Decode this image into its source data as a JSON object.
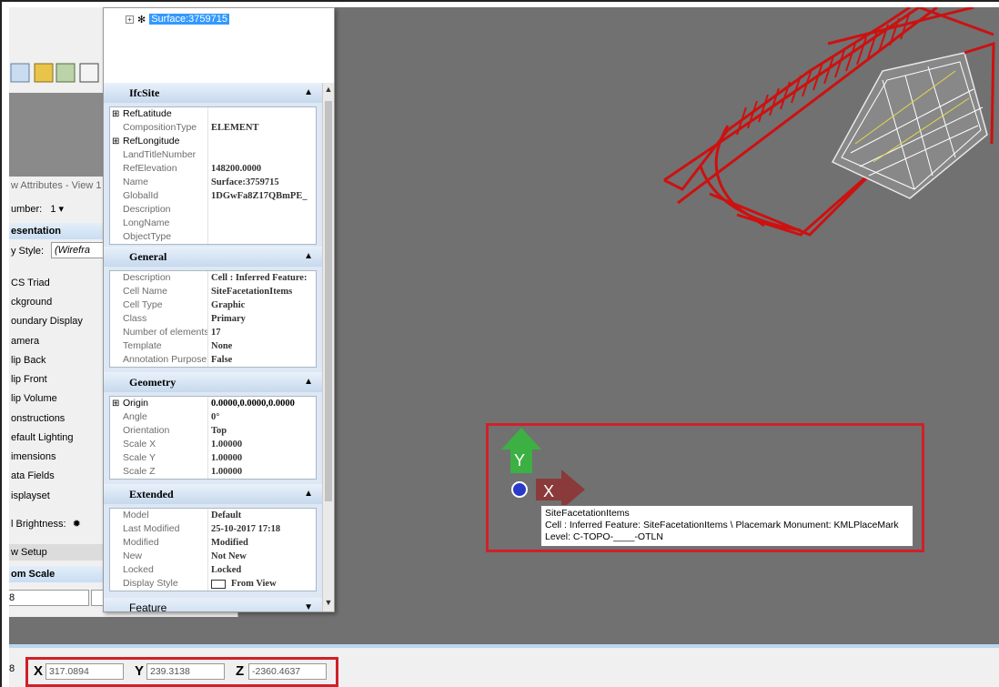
{
  "tree": {
    "node_label": "Surface:3759715"
  },
  "attributes_panel": {
    "title": "w Attributes - View 1",
    "number_label": "umber:",
    "number_value": "1",
    "presentation_header": "esentation",
    "display_style_label": "y Style:",
    "display_style_value": "(Wirefra",
    "items": [
      "CS Triad",
      "ckground",
      "oundary Display",
      "amera",
      "lip Back",
      "lip Front",
      "lip Volume",
      "onstructions",
      "efault Lighting",
      "imensions",
      "ata Fields",
      "isplayset"
    ],
    "brightness_label": "l Brightness:",
    "view_setup": "w Setup",
    "zoom_scale_header": "om Scale",
    "scale_value": "8"
  },
  "properties": {
    "ifcsite": {
      "title": "IfcSite",
      "rows": [
        {
          "name": "RefLatitude",
          "value": "",
          "expandable": true
        },
        {
          "name": "CompositionType",
          "value": "ELEMENT",
          "expandable": false
        },
        {
          "name": "RefLongitude",
          "value": "",
          "expandable": true
        },
        {
          "name": "LandTitleNumber",
          "value": "",
          "expandable": false
        },
        {
          "name": "RefElevation",
          "value": "148200.0000",
          "expandable": false
        },
        {
          "name": "Name",
          "value": "Surface:3759715",
          "expandable": false
        },
        {
          "name": "GlobalId",
          "value": "1DGwFa8Z17QBmPE_",
          "expandable": false
        },
        {
          "name": "Description",
          "value": "",
          "expandable": false
        },
        {
          "name": "LongName",
          "value": "",
          "expandable": false
        },
        {
          "name": "ObjectType",
          "value": "",
          "expandable": false
        }
      ]
    },
    "general": {
      "title": "General",
      "rows": [
        {
          "name": "Description",
          "value": "Cell : Inferred Feature:"
        },
        {
          "name": "Cell Name",
          "value": "SiteFacetationItems"
        },
        {
          "name": "Cell Type",
          "value": "Graphic"
        },
        {
          "name": "Class",
          "value": "Primary"
        },
        {
          "name": "Number of elements",
          "value": "17"
        },
        {
          "name": "Template",
          "value": "None"
        },
        {
          "name": "Annotation Purpose",
          "value": "False"
        }
      ]
    },
    "geometry": {
      "title": "Geometry",
      "rows": [
        {
          "name": "Origin",
          "value": "0.0000,0.0000,0.0000",
          "expandable": true
        },
        {
          "name": "Angle",
          "value": "0°",
          "expandable": false
        },
        {
          "name": "Orientation",
          "value": "Top",
          "expandable": false
        },
        {
          "name": "Scale X",
          "value": "1.00000",
          "expandable": false
        },
        {
          "name": "Scale Y",
          "value": "1.00000",
          "expandable": false
        },
        {
          "name": "Scale Z",
          "value": "1.00000",
          "expandable": false
        }
      ]
    },
    "extended": {
      "title": "Extended",
      "rows": [
        {
          "name": "Model",
          "value": "Default"
        },
        {
          "name": "Last Modified",
          "value": "25-10-2017 17:18"
        },
        {
          "name": "Modified",
          "value": "Modified"
        },
        {
          "name": "New",
          "value": "Not New"
        },
        {
          "name": "Locked",
          "value": "Locked"
        },
        {
          "name": "Display Style",
          "value": "From View"
        }
      ]
    },
    "feature": {
      "title": "Feature"
    }
  },
  "triad": {
    "y_label": "Y",
    "x_label": "X"
  },
  "tooltip": {
    "line1": "SiteFacetationItems",
    "line2": "Cell : Inferred Feature: SiteFacetationItems \\ Placemark Monument: KMLPlaceMark",
    "line3": "Level: C-TOPO-____-OTLN"
  },
  "status_bar": {
    "left_number": "8",
    "x_label": "X",
    "x_value": "317.0894",
    "y_label": "Y",
    "y_value": "239.3138",
    "z_label": "Z",
    "z_value": "-2360.4637"
  },
  "colors": {
    "highlight_red": "#d0202a",
    "viewport_grey": "#717171",
    "drawing_red": "#cc1111",
    "y_arrow": "#3cb043",
    "x_arrow": "#8a3a3a",
    "selection_blue": "#3399ff"
  },
  "icons": [
    "tree-expander-icon",
    "surface-node-icon",
    "collapse-chevron-icon",
    "expand-chevron-icon",
    "brightness-sun-icon",
    "display-style-icon",
    "triad-origin-icon"
  ]
}
